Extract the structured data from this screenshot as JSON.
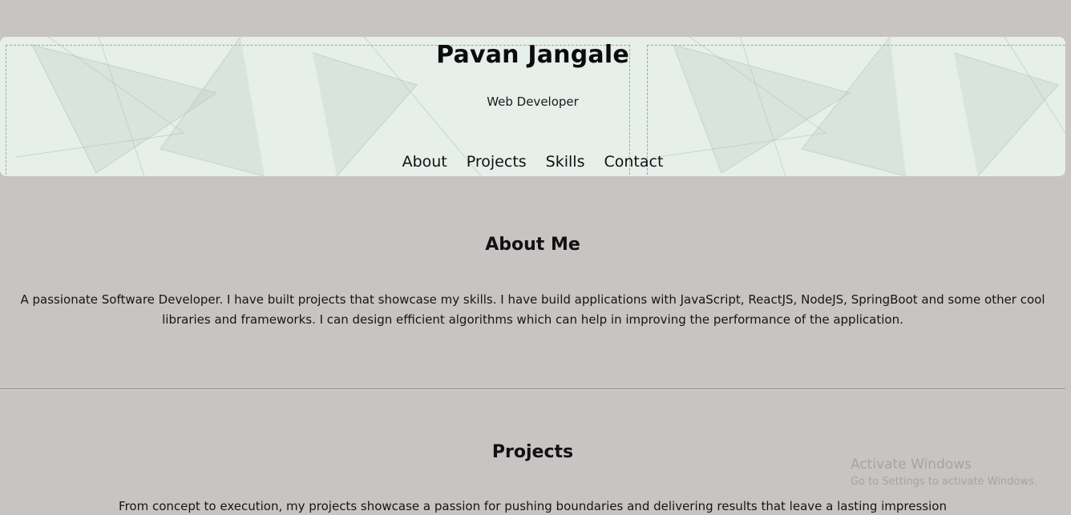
{
  "header": {
    "name": "Pavan Jangale",
    "role": "Web Developer",
    "nav": [
      "About",
      "Projects",
      "Skills",
      "Contact"
    ]
  },
  "about": {
    "title": "About Me",
    "text": "A passionate Software Developer. I have built projects that showcase my skills. I have build applications with JavaScript, ReactJS, NodeJS, SpringBoot and some other cool libraries and frameworks. I can design efficient algorithms which can help in improving the performance of the application."
  },
  "projects": {
    "title": "Projects",
    "text": "From concept to execution, my projects showcase a passion for pushing boundaries and delivering results that leave a lasting impression"
  },
  "watermark": {
    "title": "Activate Windows",
    "subtitle": "Go to Settings to activate Windows."
  },
  "colors": {
    "background": "#c8c4c3",
    "header_bg": "#e6efea"
  }
}
